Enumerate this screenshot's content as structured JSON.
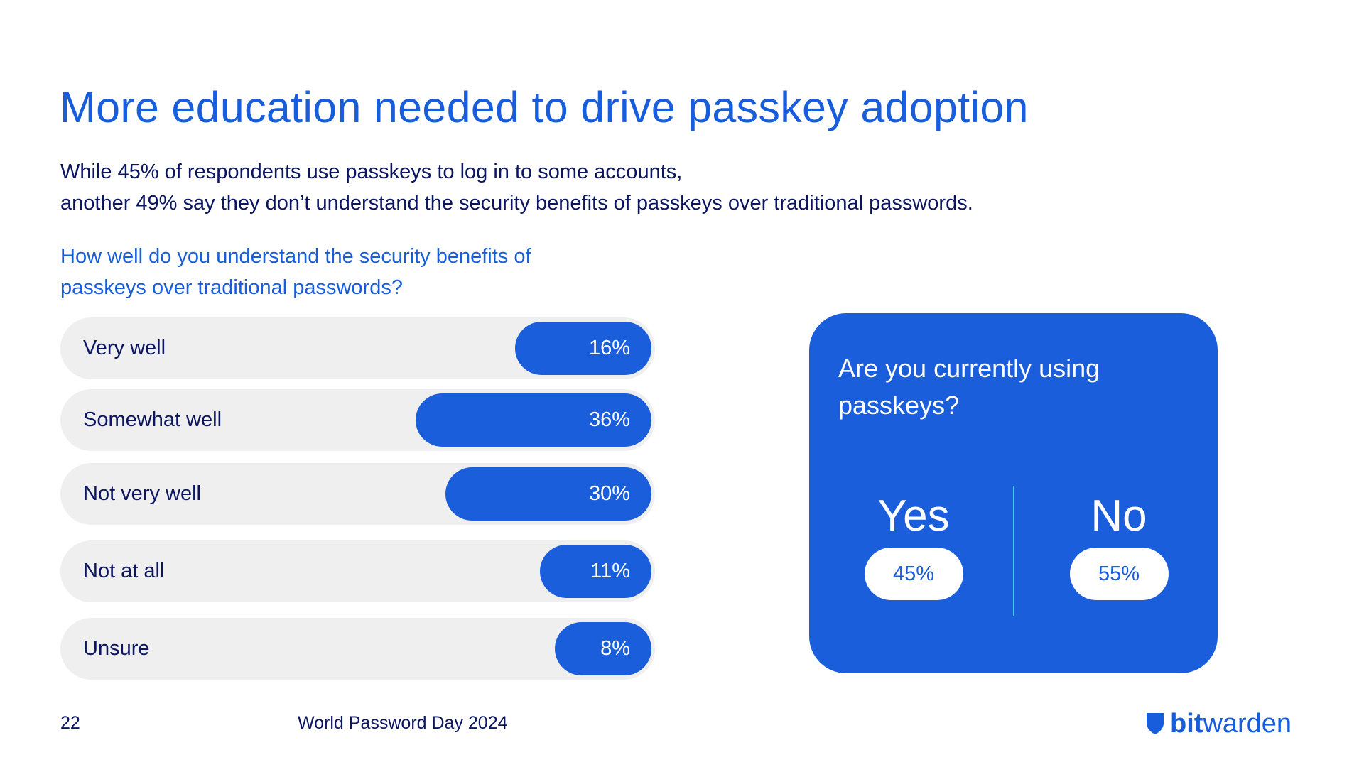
{
  "title": "More education needed to drive passkey adoption",
  "subtitle": {
    "line1": "While 45% of respondents use passkeys to log in to some accounts,",
    "line2": "another 49% say they don’t understand the security benefits of passkeys over traditional passwords."
  },
  "colors": {
    "brand_blue": "#1a5edb",
    "title_blue": "#175ddc",
    "navy_text": "#0b1560",
    "track_gray": "#efefef",
    "divider_cyan": "#49c3f0"
  },
  "chart_data": [
    {
      "type": "bar",
      "orientation": "horizontal",
      "title": "How well do you understand the security benefits of passkeys over traditional passwords?",
      "title_lines": [
        "How well do you understand the security benefits of",
        "passkeys over traditional passwords?"
      ],
      "categories": [
        "Very well",
        "Somewhat well",
        "Not very well",
        "Not at all",
        "Unsure"
      ],
      "values": [
        16,
        36,
        30,
        11,
        8
      ],
      "value_labels": [
        "16%",
        "36%",
        "30%",
        "11%",
        "8%"
      ],
      "unit": "%",
      "xlim": [
        0,
        100
      ],
      "grid": false,
      "legend": "none"
    },
    {
      "type": "table",
      "title": "Are you currently using passkeys?",
      "title_lines": [
        "Are you currently using",
        "passkeys?"
      ],
      "categories": [
        "Yes",
        "No"
      ],
      "values": [
        45,
        55
      ],
      "value_labels": [
        "45%",
        "55%"
      ],
      "unit": "%"
    }
  ],
  "footer": {
    "page_number": "22",
    "event": "World Password Day 2024",
    "logo": {
      "icon": "shield-icon",
      "bold": "bit",
      "light": "warden"
    }
  }
}
